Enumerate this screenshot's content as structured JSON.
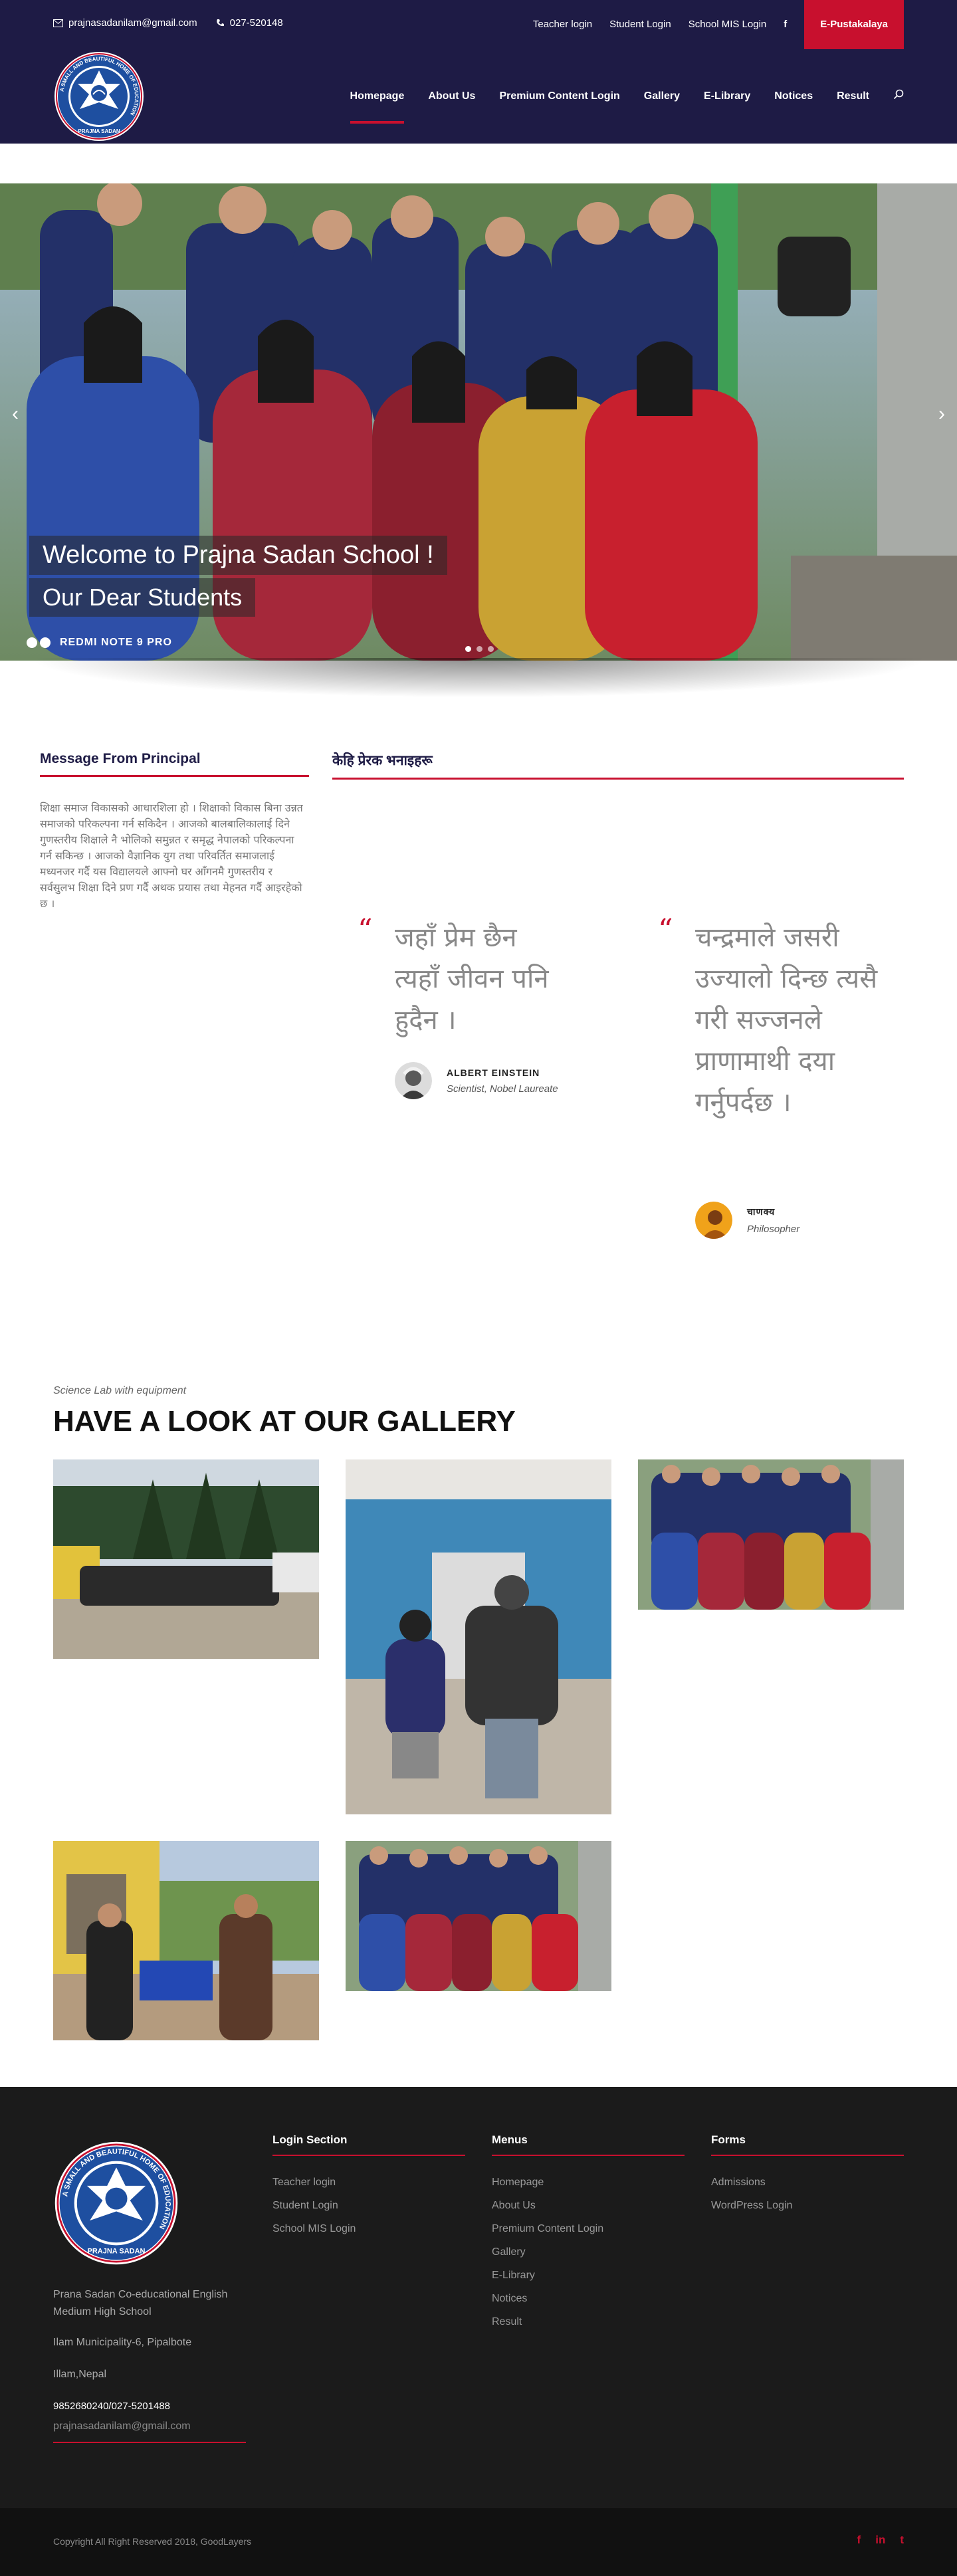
{
  "topbar": {
    "email": "prajnasadanilam@gmail.com",
    "phone": "027-520148",
    "links": [
      "Teacher login",
      "Student Login",
      "School MIS Login"
    ],
    "facebook": "f",
    "cta": "E-Pustakalaya"
  },
  "nav": {
    "items": [
      "Homepage",
      "About Us",
      "Premium Content Login",
      "Gallery",
      "E-Library",
      "Notices",
      "Result"
    ],
    "active": "Homepage"
  },
  "logo": {
    "ring_text": "A SMALL AND BEAUTIFUL HOME OF EDUCATION",
    "bottom_text": "PRAJNA SADAN"
  },
  "hero": {
    "caption1": "Welcome to Prajna Sadan School !",
    "caption2": "Our Dear Students",
    "watermark": "REDMI NOTE 9 PRO"
  },
  "principal": {
    "title": "Message From Principal",
    "text": "शिक्षा समाज विकासको आधारशिला हो । शिक्षाको विकास बिना उन्नत समाजको परिकल्पना गर्न सकिदैन । आजको बालबालिकालाई दिने गुणस्तरीय शिक्षाले नै भोलिको समुन्नत र समृद्ध नेपालको परिकल्पना गर्न सकिन्छ । आजको वैज्ञानिक युग तथा परिवर्तित समाजलाई मध्यनजर गर्दै यस विद्यालयले आफ्नो घर आँगनमै गुणस्तरीय र सर्वसुलभ शिक्षा दिने प्रण गर्दै अथक प्रयास तथा मेहनत गर्दै आइरहेको छ ।"
  },
  "quotes": {
    "title": "केहि प्रेरक भनाइहरू",
    "items": [
      {
        "text": "जहाँ प्रेम छैन त्यहाँ जीवन पनि हुदैन ।",
        "author": "ALBERT EINSTEIN",
        "role": "Scientist, Nobel Laureate"
      },
      {
        "text": "चन्द्रमाले जसरी उज्यालो दिन्छ त्यसै गरी सज्जनले प्राणामाथी दया गर्नुपर्दछ ।",
        "author": "चाणक्य",
        "role": "Philosopher"
      }
    ]
  },
  "gallery": {
    "subtitle": "Science Lab with equipment",
    "title": "HAVE A LOOK AT OUR GALLERY"
  },
  "footer": {
    "info": [
      "Prana Sadan Co-educational English Medium High School",
      "Ilam Municipality-6, Pipalbote",
      "Illam,Nepal",
      "9852680240/027-5201488",
      "prajnasadanilam@gmail.com"
    ],
    "columns": [
      {
        "title": "Login Section",
        "links": [
          "Teacher login",
          "Student Login",
          "School MIS Login"
        ]
      },
      {
        "title": "Menus",
        "links": [
          "Homepage",
          "About Us",
          "Premium Content Login",
          "Gallery",
          "E-Library",
          "Notices",
          "Result"
        ]
      },
      {
        "title": "Forms",
        "links": [
          "Admissions",
          "WordPress Login"
        ]
      }
    ],
    "copyright": "Copyright All Right Reserved 2018, GoodLayers",
    "social": [
      "f",
      "in",
      "t"
    ]
  },
  "colors": {
    "navy": "#1e1b45",
    "accent": "#c8102e",
    "footer": "#1b1b1b"
  }
}
